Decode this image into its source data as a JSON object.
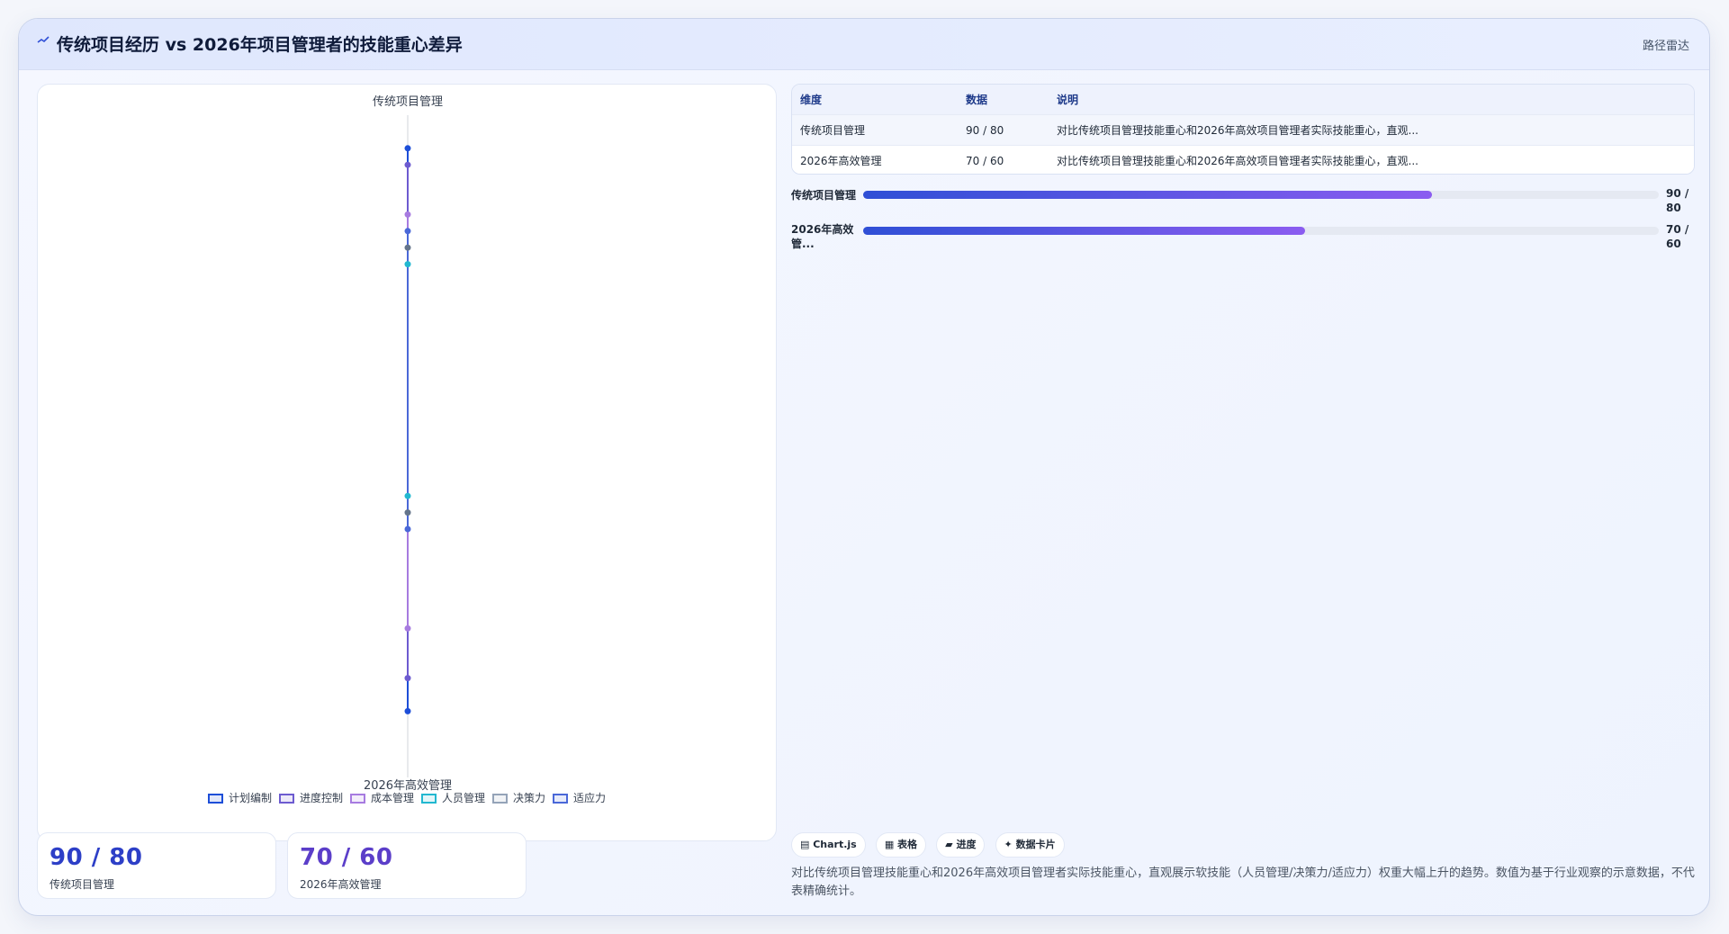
{
  "header": {
    "title": "传统项目经历 vs 2026年项目管理者的技能重心差异",
    "tag": "路径雷达"
  },
  "chart_data": {
    "type": "radar",
    "axis_top_label": "传统项目管理",
    "axis_bottom_label": "2026年高效管理",
    "categories": [
      "计划编制",
      "进度控制",
      "成本管理",
      "人员管理",
      "决策力",
      "适应力"
    ],
    "legend": [
      {
        "name": "计划编制",
        "color": "#1d4ed8"
      },
      {
        "name": "进度控制",
        "color": "#6d5bd0"
      },
      {
        "name": "成本管理",
        "color": "#a77be0"
      },
      {
        "name": "人员管理",
        "color": "#22b8d0"
      },
      {
        "name": "决策力",
        "color": "#94a3b8"
      },
      {
        "name": "适应力",
        "color": "#4a68d8"
      }
    ],
    "series": [
      {
        "name": "计划编制",
        "values": [
          90,
          80
        ],
        "color": "#1d4ed8"
      },
      {
        "name": "进度控制",
        "values": [
          85,
          70
        ],
        "color": "#6d5bd0"
      },
      {
        "name": "成本管理",
        "values": [
          70,
          55
        ],
        "color": "#a77be0"
      },
      {
        "name": "人员管理",
        "values": [
          55,
          15
        ],
        "color": "#22b8d0"
      },
      {
        "name": "决策力",
        "values": [
          60,
          20
        ],
        "color": "#64748b"
      },
      {
        "name": "适应力",
        "values": [
          65,
          25
        ],
        "color": "#4a68d8"
      }
    ],
    "rlim": [
      0,
      100
    ]
  },
  "stats": [
    {
      "value": "90 / 80",
      "label": "传统项目管理",
      "color": "#2d3fc7"
    },
    {
      "value": "70 / 60",
      "label": "2026年高效管理",
      "color": "#5b3ec9"
    }
  ],
  "table": {
    "headers": [
      "维度",
      "数据",
      "说明"
    ],
    "rows": [
      [
        "传统项目管理",
        "90 / 80",
        "对比传统项目管理技能重心和2026年高效项目管理者实际技能重心，直观..."
      ],
      [
        "2026年高效管理",
        "70 / 60",
        "对比传统项目管理技能重心和2026年高效项目管理者实际技能重心，直观..."
      ]
    ]
  },
  "progress": [
    {
      "label": "传统项目管理",
      "value_text": "90 / 80",
      "percent": 71.5
    },
    {
      "label": "2026年高效管...",
      "value_text": "70 / 60",
      "percent": 55.5
    }
  ],
  "chips": [
    "▤ Chart.js",
    "▦ 表格",
    "▰ 进度",
    "✦ 数据卡片"
  ],
  "note": "对比传统项目管理技能重心和2026年高效项目管理者实际技能重心，直观展示软技能（人员管理/决策力/适应力）权重大幅上升的趋势。数值为基于行业观察的示意数据，不代表精确统计。"
}
